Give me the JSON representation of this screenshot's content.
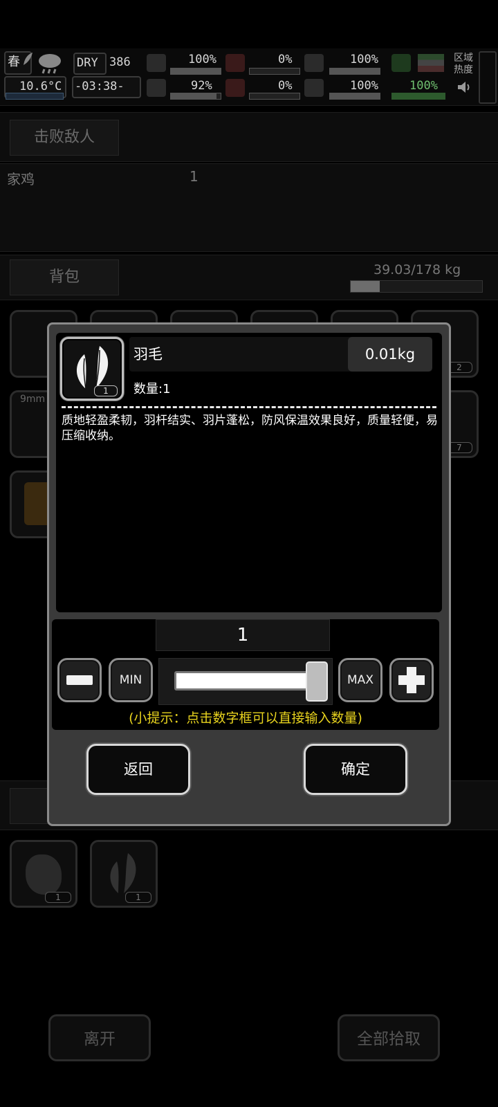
{
  "hud": {
    "season": "春",
    "temperature": "10.6°C",
    "weather_tag": "DRY",
    "day": "386",
    "time": "-03:38-",
    "stats_left": [
      "100%",
      "92%"
    ],
    "stats_mid": [
      "0%",
      "0%"
    ],
    "stats_right": [
      "100%",
      "100%"
    ],
    "stat_far": "100%",
    "zone_label": "区域热度",
    "icons": [
      "leaf-icon",
      "rain-cloud-icon",
      "medkit-icon",
      "brain-icon",
      "stomach-icon",
      "water-drop-icon",
      "lungs-icon",
      "heart-icon",
      "flask-icon",
      "speaker-icon"
    ]
  },
  "background": {
    "defeat_tab": "击败敌人",
    "enemy_name": "家鸡",
    "enemy_count": "1",
    "backpack_tab": "背包",
    "weight": "39.03/178 kg",
    "weight_fraction": 0.22,
    "slot_counts": [
      "2",
      "7"
    ],
    "ammo_label": "9mm",
    "loot_counts": [
      "1",
      "1"
    ],
    "leave_button": "离开",
    "pickup_all_button": "全部拾取"
  },
  "dialog": {
    "item_name": "羽毛",
    "item_weight": "0.01kg",
    "icon_count": "1",
    "quantity_label": "数量:1",
    "description": "质地轻盈柔韧，羽杆结实、羽片蓬松，防风保温效果良好，质量轻便，易压缩收纳。",
    "quantity_value": "1",
    "min_label": "MIN",
    "max_label": "MAX",
    "slider_fraction": 1.0,
    "hint": "(小提示：点击数字框可以直接输入数量)",
    "back_button": "返回",
    "confirm_button": "确定"
  },
  "colors": {
    "hint": "#e8d31e",
    "dialog_bg": "#3a3a3a",
    "dialog_border": "#8a8a8a"
  }
}
